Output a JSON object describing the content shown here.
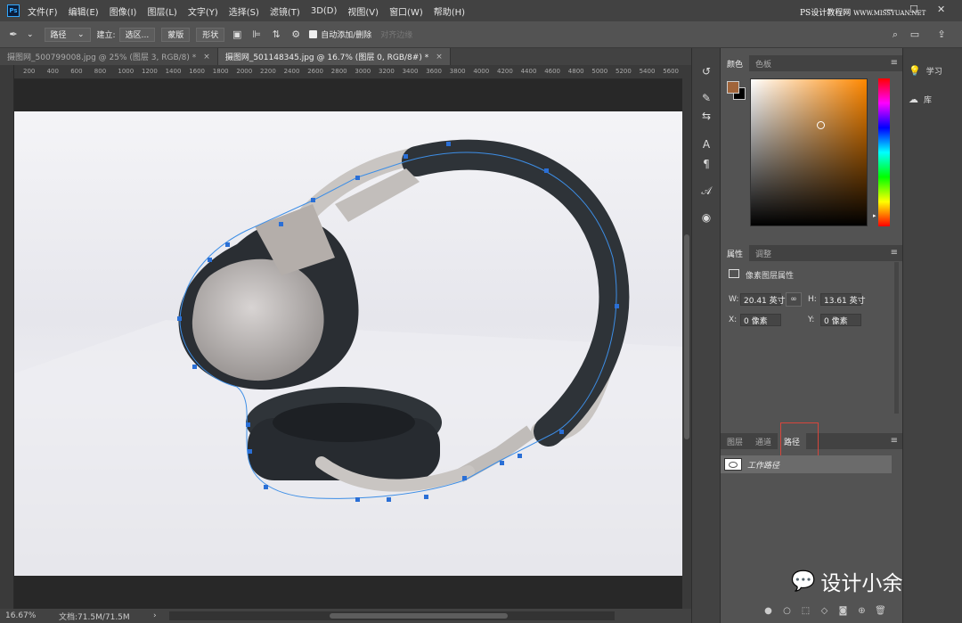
{
  "app": {
    "logo": "Ps"
  },
  "menu": [
    "文件(F)",
    "编辑(E)",
    "图像(I)",
    "图层(L)",
    "文字(Y)",
    "选择(S)",
    "滤镜(T)",
    "3D(D)",
    "视图(V)",
    "窗口(W)",
    "帮助(H)"
  ],
  "watermark_top": "PS设计教程网",
  "watermark_url": "WWW.MISSYUAN.NET",
  "window_controls": {
    "minimize": "—",
    "maximize": "☐",
    "close": "✕"
  },
  "options": {
    "mode": "路径",
    "create_label": "建立:",
    "selection_btn": "选区...",
    "mask_btn": "蒙版",
    "shape_btn": "形状",
    "auto_add_label": "自动添加/删除",
    "align_edges_label": "对齐边缘"
  },
  "tabs": [
    {
      "label": "摄图网_500799008.jpg @ 25% (图层 3, RGB/8) *",
      "close": "×"
    },
    {
      "label": "摄图网_501148345.jpg @ 16.7% (图层 0, RGB/8#) *",
      "close": "×"
    }
  ],
  "ruler_h": [
    "200",
    "400",
    "600",
    "800",
    "1000",
    "1200",
    "1400",
    "1600",
    "1800",
    "2000",
    "2200",
    "2400",
    "2600",
    "2800",
    "3000",
    "3200",
    "3400",
    "3600",
    "3800",
    "4000",
    "4200",
    "4400",
    "4600",
    "4800",
    "5000",
    "5200",
    "5400",
    "5600"
  ],
  "status": {
    "zoom": "16.67%",
    "doc": "文档:71.5M/71.5M",
    "arrow": "›"
  },
  "color_panel": {
    "tabs": [
      "颜色",
      "色板"
    ],
    "fg": "#a0643a",
    "bg": "#000000",
    "hue_base": "#ff8800"
  },
  "properties_panel": {
    "tabs": [
      "属性",
      "调整"
    ],
    "title": "像素图层属性",
    "w_label": "W:",
    "w_value": "20.41 英寸",
    "h_label": "H:",
    "h_value": "13.61 英寸",
    "x_label": "X:",
    "x_value": "0 像素",
    "y_label": "Y:",
    "y_value": "0 像素"
  },
  "paths_panel": {
    "tabs": [
      "图层",
      "通道",
      "路径"
    ],
    "work_path": "工作路径"
  },
  "dock": {
    "learn": "学习",
    "library": "库"
  },
  "brand": "设计小余",
  "icons": {
    "pen": "✒",
    "settings": "⚙",
    "search": "⌕",
    "workspace": "▭",
    "share": "⇪",
    "highlight": "#d6463c"
  }
}
